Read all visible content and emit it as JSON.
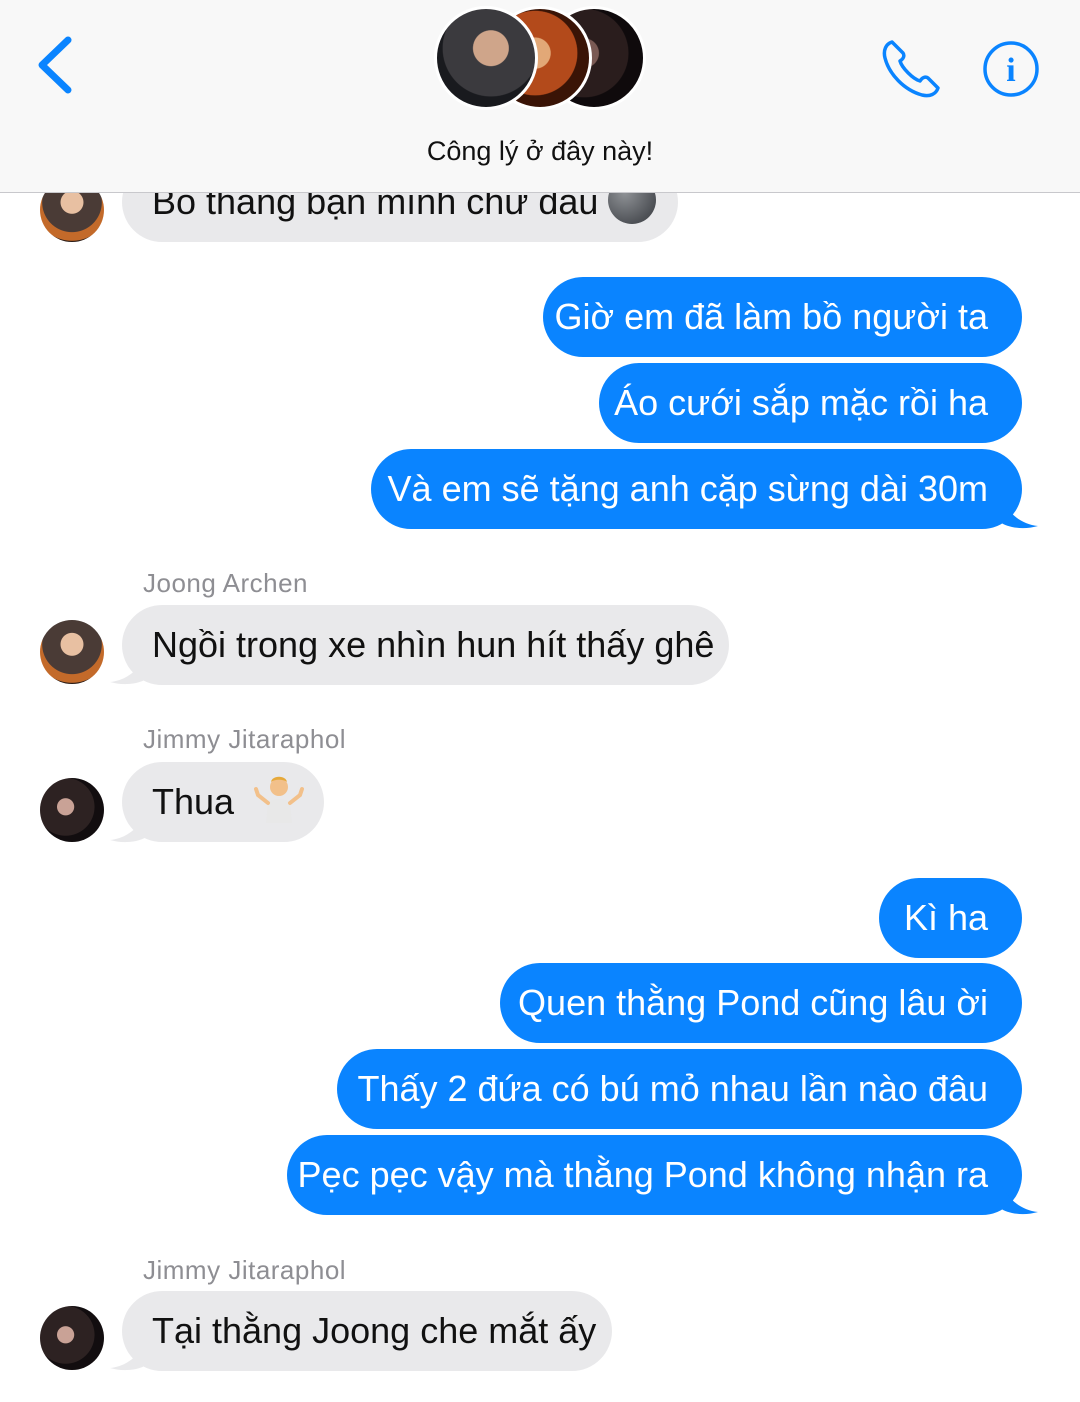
{
  "header": {
    "title": "Công lý ở đây này!",
    "accent_color": "#0a84ff",
    "back_icon": "chevron-left-icon",
    "call_icon": "phone-icon",
    "info_icon": "info-icon",
    "info_glyph": "i"
  },
  "messages": {
    "m0": "Bồ thằng bạn mình chứ đâu",
    "m1": "Giờ em đã làm bồ người ta",
    "m2": "Áo cưới sắp mặc rồi ha",
    "m3": "Và em sẽ tặng anh cặp sừng dài 30m",
    "s4": "Joong Archen",
    "m4": "Ngồi trong xe nhìn hun hít thấy ghê",
    "s5": "Jimmy Jitaraphol",
    "m5": "Thua",
    "m6": "Kì ha",
    "m7": "Quen thằng Pond cũng lâu ời",
    "m8": "Thấy 2 đứa có bú mỏ nhau lần nào đâu",
    "m9": "Pẹc pẹc vậy mà thằng Pond không nhận ra",
    "s10": "Jimmy Jitaraphol",
    "m10": "Tại thằng Joong che mắt ấy"
  },
  "colors": {
    "sent_bubble": "#0a84ff",
    "received_bubble": "#e9e9eb",
    "sender_name": "#8e8e93"
  }
}
